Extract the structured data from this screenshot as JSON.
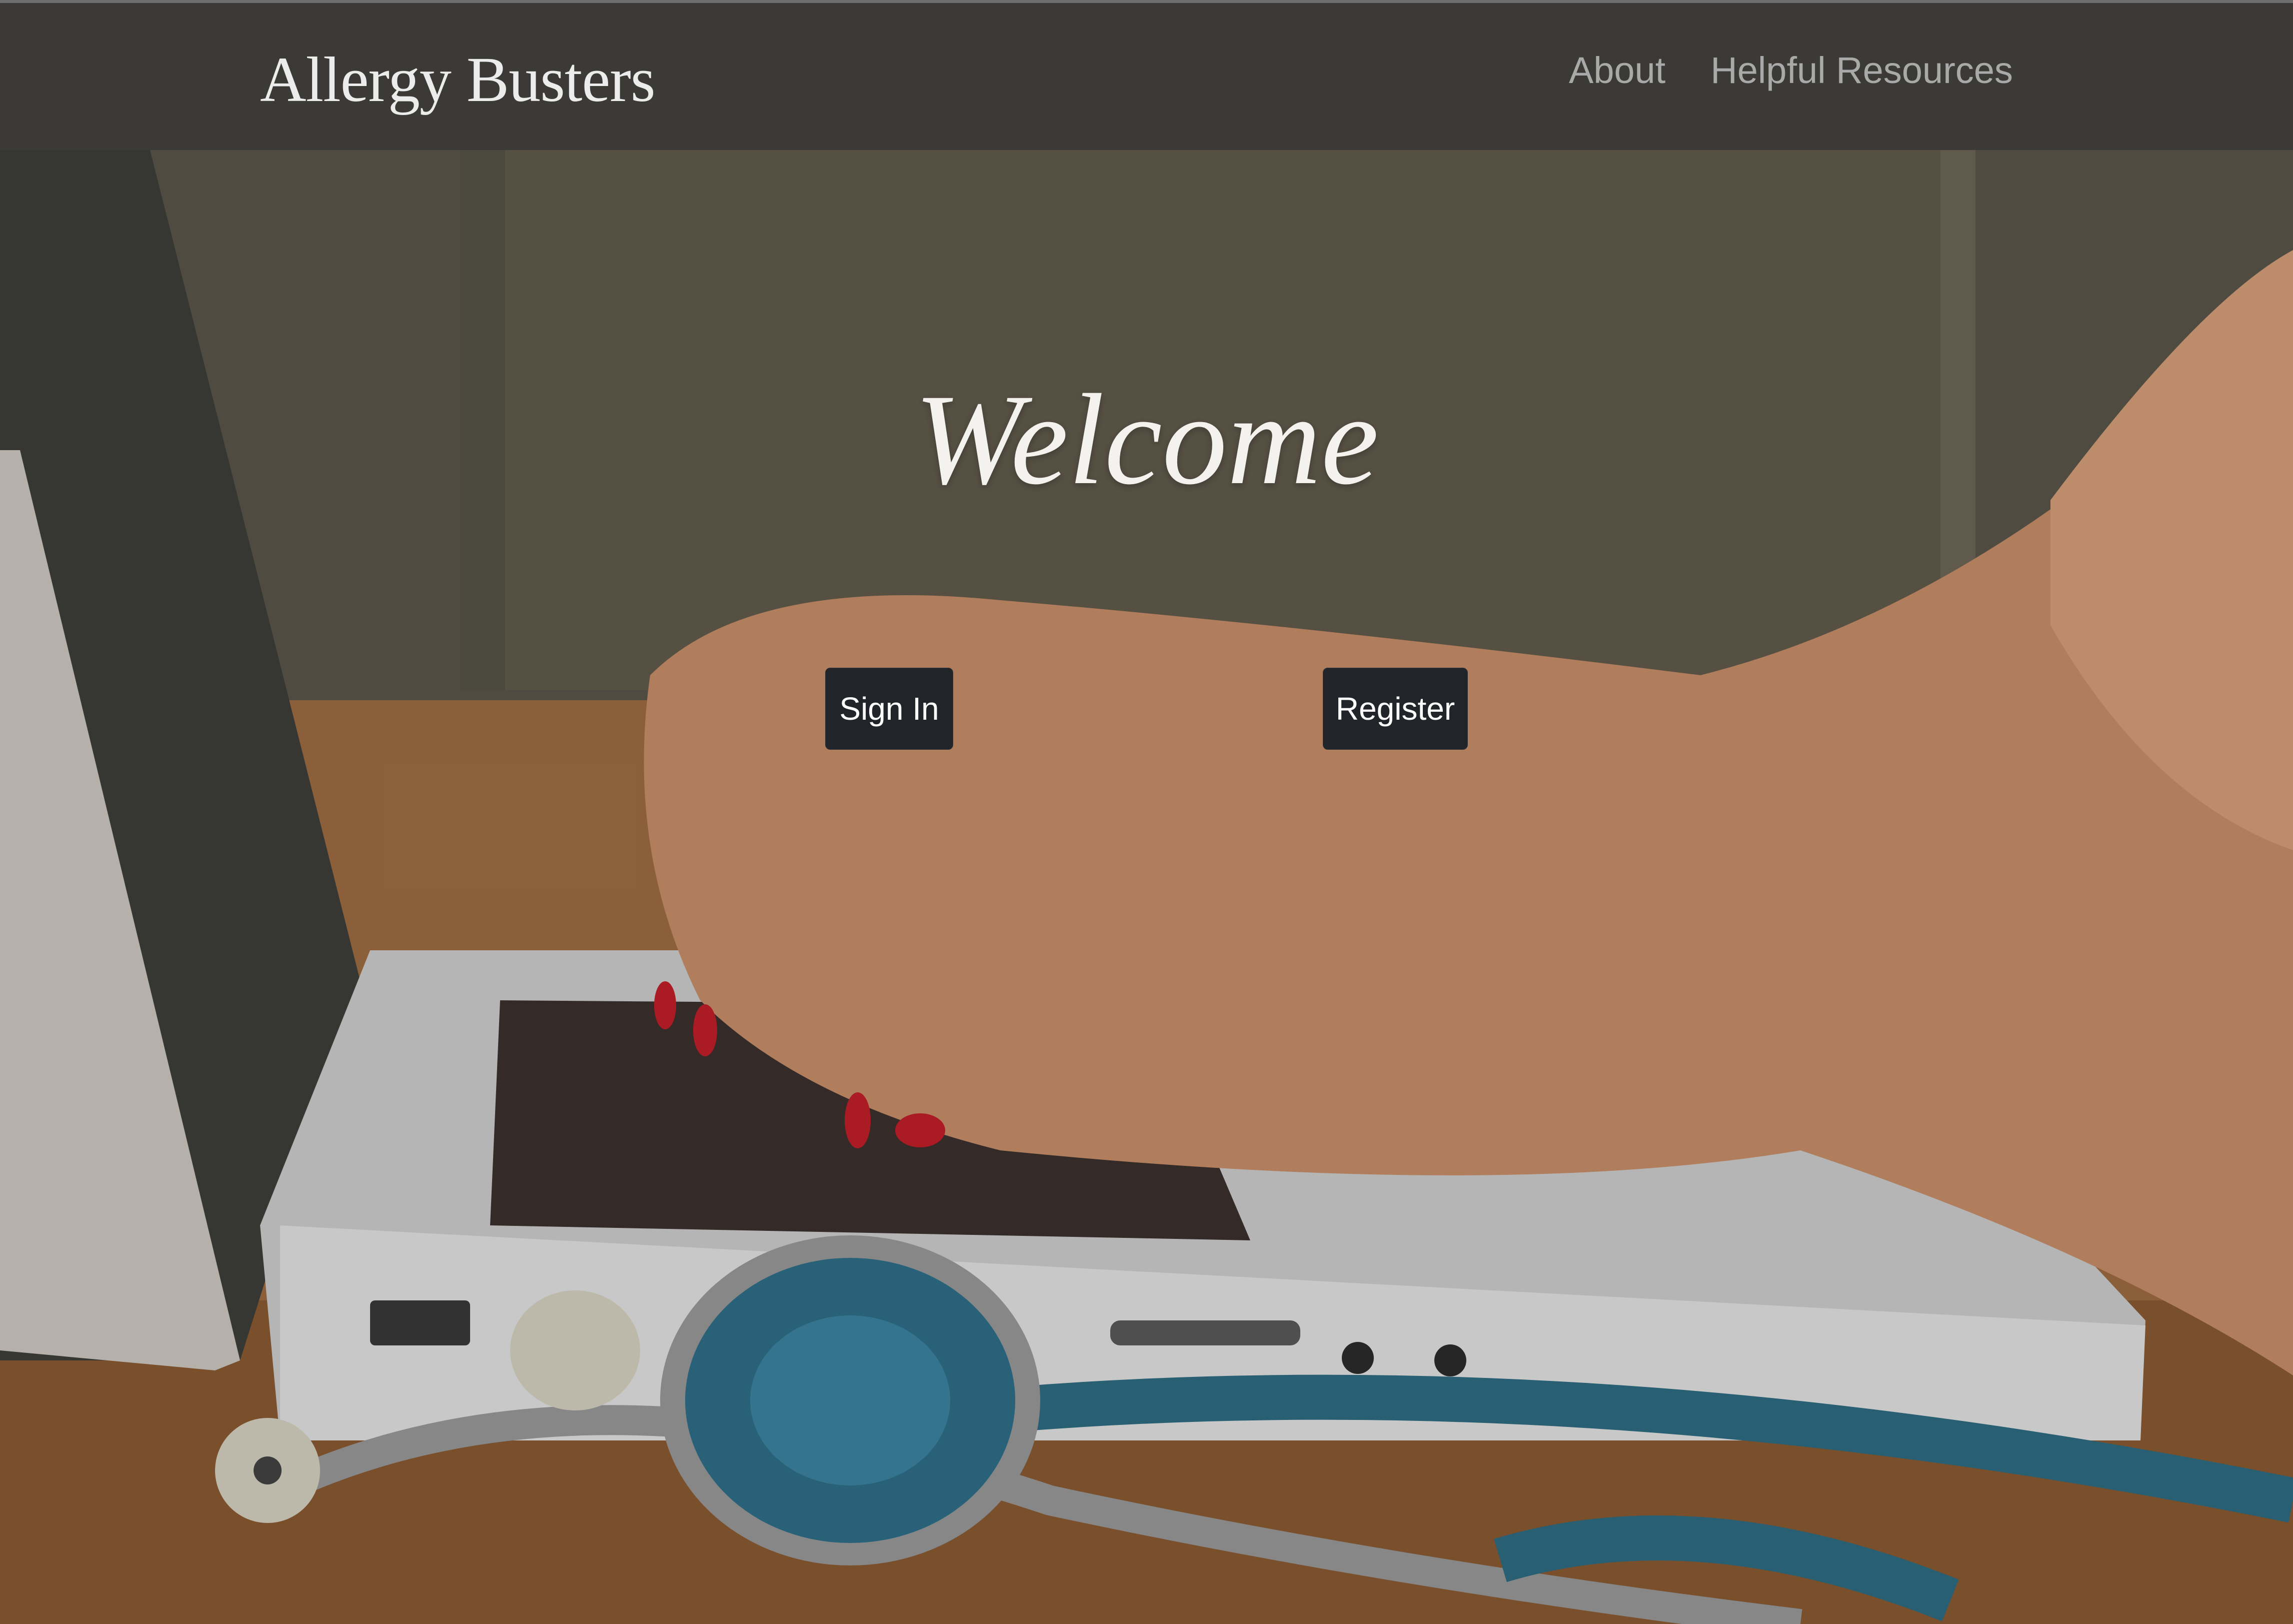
{
  "navbar": {
    "brand": "Allergy Busters",
    "links": [
      {
        "label": "About"
      },
      {
        "label": "Helpful Resources"
      }
    ]
  },
  "hero": {
    "title": "Welcome",
    "buttons": {
      "sign_in": "Sign In",
      "register": "Register"
    }
  },
  "colors": {
    "navbar_bg": "#3b3a36",
    "button_bg": "#21252a",
    "nav_link": "#a9a9a9"
  }
}
